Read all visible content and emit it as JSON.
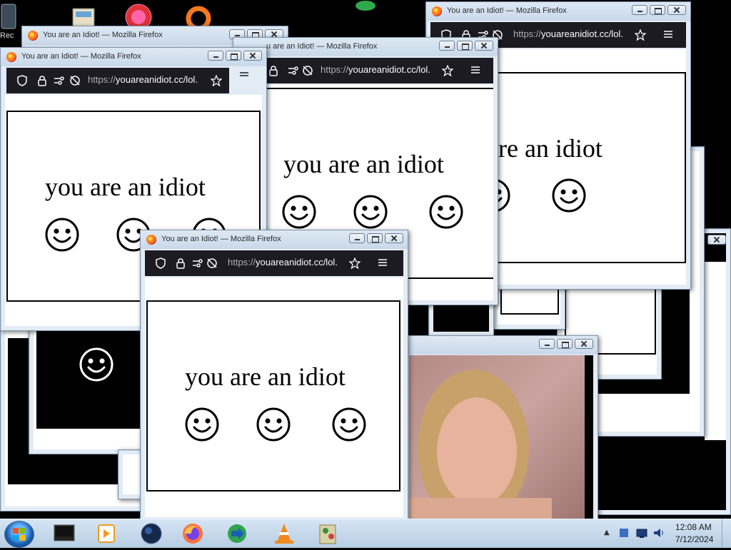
{
  "desktop": {
    "partial_label": "Rec"
  },
  "window_common": {
    "title": "You are an Idiot! — Mozilla Firefox",
    "url_proto": "https://",
    "url_rest": "youareanidiot.cc/lol.",
    "message": "you are an idiot"
  },
  "window_partial": {
    "title": "u are an Idiot! — Mozilla Firefox"
  },
  "icons": {
    "shield": "shield-icon",
    "lock": "lock-icon",
    "permissions": "permissions-icon",
    "tracking": "tracking-protection-icon",
    "bookmark": "bookmark-star-icon",
    "menu": "hamburger-menu-icon",
    "smiley": "smiley-face-icon"
  },
  "taskbar": {
    "pinned": [
      "desktop-app",
      "media-player",
      "globe-app",
      "firefox",
      "internet-download-manager",
      "vlc",
      "paint-app"
    ],
    "clock": {
      "time": "12:08 AM",
      "date": "7/12/2024"
    }
  }
}
